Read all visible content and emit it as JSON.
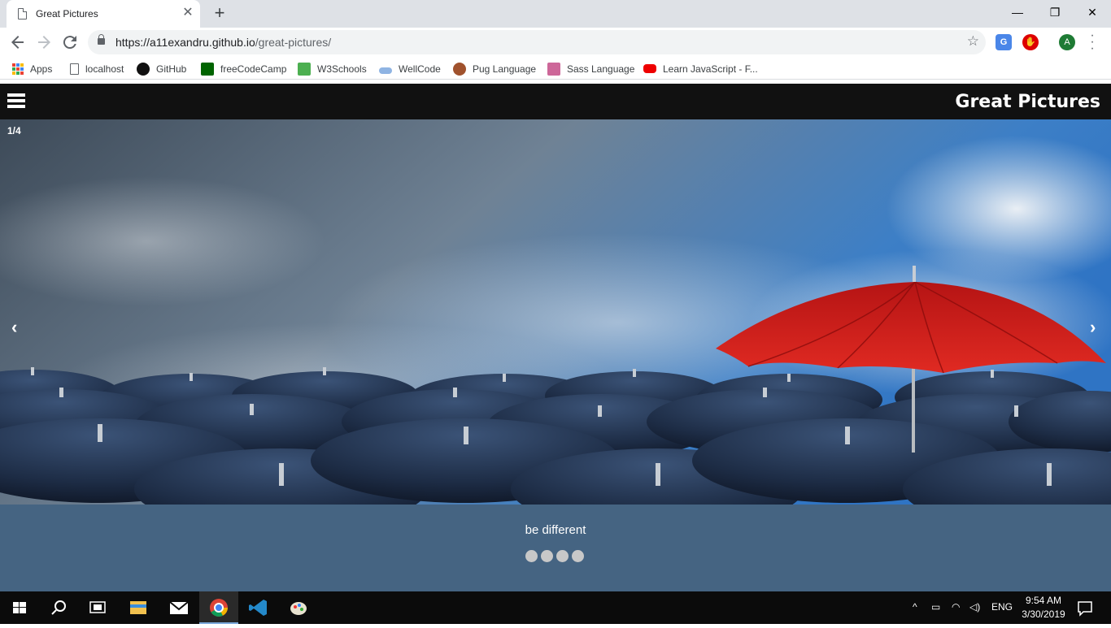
{
  "browser": {
    "tab_title": "Great Pictures",
    "tab_close": "✕",
    "new_tab": "+",
    "window_controls": {
      "minimize": "—",
      "restore": "❐",
      "close": "✕"
    },
    "url_host": "https://a11exandru.github.io",
    "url_path": "/great-pictures/",
    "profile_initial": "A",
    "bookmarks": [
      {
        "label": "Apps",
        "icon": "apps-grid-icon"
      },
      {
        "label": "localhost",
        "icon": "page-icon"
      },
      {
        "label": "GitHub",
        "icon": "github-icon"
      },
      {
        "label": "freeCodeCamp",
        "icon": "freecodecamp-icon"
      },
      {
        "label": "W3Schools",
        "icon": "w3schools-icon"
      },
      {
        "label": "WellCode",
        "icon": "wellcode-icon"
      },
      {
        "label": "Pug Language",
        "icon": "pug-icon"
      },
      {
        "label": "Sass Language",
        "icon": "sass-icon"
      },
      {
        "label": "Learn JavaScript - F...",
        "icon": "youtube-icon"
      }
    ]
  },
  "page": {
    "site_title": "Great Pictures",
    "slide_counter": "1/4",
    "prev_arrow": "‹",
    "next_arrow": "›",
    "caption": "be different",
    "dot_count": 4,
    "active_dot": 1
  },
  "taskbar": {
    "language": "ENG",
    "time": "9:54 AM",
    "date": "3/30/2019"
  },
  "colors": {
    "header_bg": "#111111",
    "caption_bg": "#456482",
    "dot": "#c8c8c8",
    "accent_umbrella": "#c81818"
  }
}
